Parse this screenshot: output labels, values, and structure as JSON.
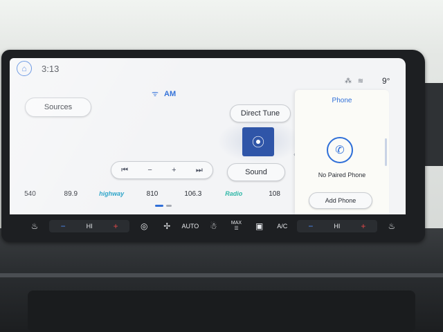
{
  "status": {
    "time": "3:13",
    "temperature": "9°",
    "signal_icons": "⁂ ≋"
  },
  "radio": {
    "band_label": "AM",
    "sources_label": "Sources",
    "direct_tune_label": "Direct Tune",
    "sound_label": "Sound"
  },
  "controls": {
    "seek_back": "⏮",
    "minus": "−",
    "plus": "+",
    "seek_forward": "⏭"
  },
  "presets": [
    {
      "label": "540"
    },
    {
      "label": "89.9"
    },
    {
      "label": "highway",
      "logo": true
    },
    {
      "label": "810"
    },
    {
      "label": "106.3"
    },
    {
      "label": "Radio",
      "logo": true
    },
    {
      "label": "108"
    }
  ],
  "phone": {
    "title": "Phone",
    "status": "No Paired Phone",
    "add_label": "Add Phone"
  },
  "climate": {
    "left_hi": "HI",
    "auto": "AUTO",
    "max": "MAX",
    "ac": "A/C",
    "right_hi": "HI"
  },
  "colors": {
    "accent": "#2f6fd8",
    "tile": "#2f55a8",
    "minus": "#4d8cf5",
    "plus": "#e04848"
  }
}
